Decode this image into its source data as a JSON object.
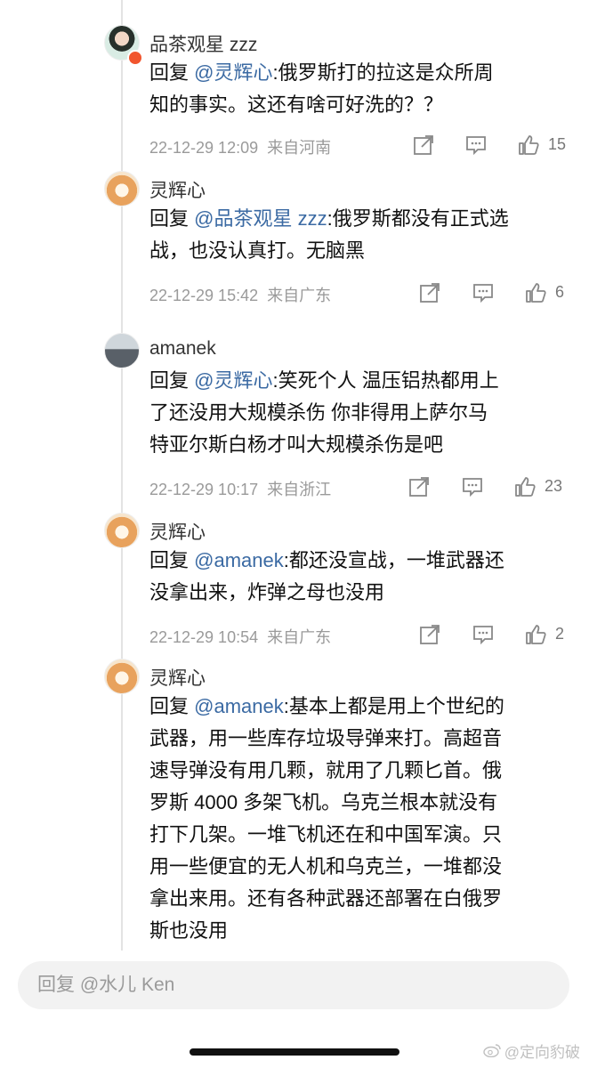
{
  "comments": [
    {
      "username": "品茶观星 zzz",
      "reply_prefix": "回复 ",
      "mention": "@灵辉心",
      "lines": [
        ":俄罗斯打的拉这是众所周",
        "知的事实。这还有啥可好洗的？？"
      ],
      "time": "22-12-29 12:09",
      "location": "来自河南",
      "likes": "15"
    },
    {
      "username": "灵辉心",
      "reply_prefix": "回复 ",
      "mention": "@品茶观星 zzz",
      "lines": [
        ":俄罗斯都没有正式选",
        "战，也没认真打。无脑黑"
      ],
      "time": "22-12-29 15:42",
      "location": "来自广东",
      "likes": "6"
    },
    {
      "username": "amanek",
      "reply_prefix": "回复 ",
      "mention": "@灵辉心",
      "lines": [
        ":笑死个人 温压铝热都用上",
        "了还没用大规模杀伤 你非得用上萨尔马",
        "特亚尔斯白杨才叫大规模杀伤是吧"
      ],
      "time": "22-12-29 10:17",
      "location": "来自浙江",
      "likes": "23"
    },
    {
      "username": "灵辉心",
      "reply_prefix": "回复 ",
      "mention": "@amanek",
      "lines": [
        ":都还没宣战，一堆武器还",
        "没拿出来，炸弹之母也没用"
      ],
      "time": "22-12-29 10:54",
      "location": "来自广东",
      "likes": "2"
    },
    {
      "username": "灵辉心",
      "reply_prefix": "回复 ",
      "mention": "@amanek",
      "lines": [
        ":基本上都是用上个世纪的",
        "武器，用一些库存垃圾导弹来打。高超音",
        "速导弹没有用几颗，就用了几颗匕首。俄",
        "罗斯 4000 多架飞机。乌克兰根本就没有",
        "打下几架。一堆飞机还在和中国军演。只",
        "用一些便宜的无人机和乌克兰，一堆都没",
        "拿出来用。还有各种武器还部署在白俄罗",
        "斯也没用"
      ]
    }
  ],
  "reply_input": {
    "placeholder": "回复 @水儿 Ken"
  },
  "watermark": {
    "text": "@定向豹破"
  },
  "icons": {
    "share": "share-icon",
    "comment": "comment-icon",
    "like": "like-icon"
  }
}
